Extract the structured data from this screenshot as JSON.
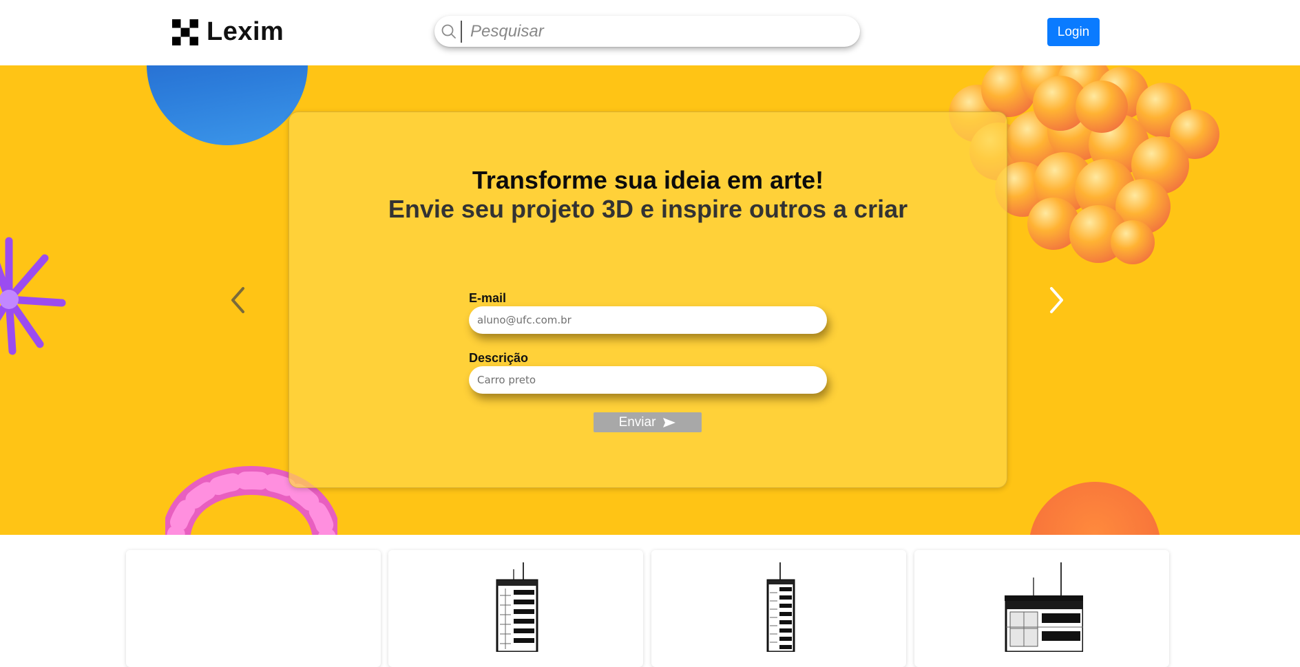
{
  "header": {
    "brand": "Lexim",
    "logo_icon": "pixel-x-logo-icon",
    "search": {
      "placeholder": "Pesquisar",
      "value": "",
      "icon": "search-icon"
    },
    "login_label": "Login"
  },
  "hero": {
    "title": "Transforme sua ideia em arte!",
    "subtitle": "Envie seu projeto 3D e inspire outros a criar",
    "form": {
      "email_label": "E-mail",
      "email_placeholder": "aluno@ufc.com.br",
      "description_label": "Descrição",
      "description_placeholder": "Carro preto",
      "submit_label": "Enviar",
      "submit_icon": "send-icon"
    },
    "carousel": {
      "prev_icon": "chevron-left-icon",
      "next_icon": "chevron-right-icon"
    },
    "colors": {
      "background": "#ffc415",
      "card": "#ffd648",
      "send_button": "#a8a8a8",
      "login_button": "#0a7bff"
    }
  },
  "products": [
    {
      "image": "blank"
    },
    {
      "image": "building-icon"
    },
    {
      "image": "building-icon"
    },
    {
      "image": "building-icon"
    }
  ]
}
